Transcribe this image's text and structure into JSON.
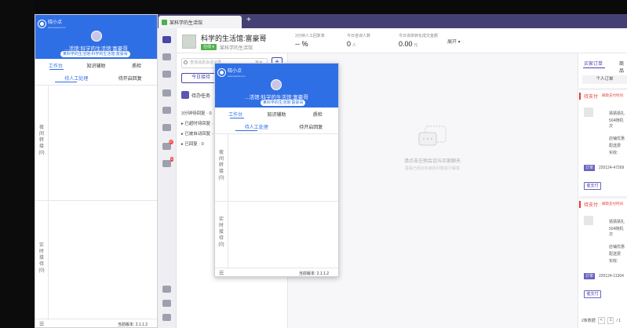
{
  "app": {
    "tab_title": "某科学的生活馆",
    "new_tab": "+"
  },
  "iconbar": {
    "items": [
      {
        "icon": "chat-icon"
      },
      {
        "icon": "doc-icon"
      },
      {
        "icon": "bag-icon"
      },
      {
        "icon": "chart-icon"
      },
      {
        "icon": "grid-icon"
      },
      {
        "icon": "shield-icon"
      },
      {
        "icon": "calendar-icon",
        "badge": "67"
      },
      {
        "icon": "megaphone-icon",
        "badge": "5"
      }
    ],
    "bottom": [
      {
        "icon": "video-icon"
      },
      {
        "icon": "home-icon"
      },
      {
        "icon": "menu-icon"
      }
    ]
  },
  "header": {
    "shop_name": "科学的生活馆:富豪哥",
    "status": "在线 ▾",
    "sub_name": "某科学的生活馆",
    "stats": [
      {
        "label": "3分钟人工回复率",
        "value": "-- %",
        "unit": ""
      },
      {
        "label": "今日咨询人数",
        "value": "0",
        "unit": "人"
      },
      {
        "label": "今日询单转化成交金额",
        "value": "0.00",
        "unit": "元"
      }
    ],
    "expand": "展开 ▾"
  },
  "convlist": {
    "search_placeholder": "查询消息会话记录",
    "search_more": "更多",
    "add": "+",
    "today_btn": "今日接待",
    "pending_title": "待办任务",
    "groups": [
      "3分钟待回复 · 0",
      "▸ 已超时待回复 · 0",
      "▸ 已被自动回复 · 0",
      "▸ 已回复 · 0"
    ]
  },
  "chat": {
    "empty_text": "请点击左侧会话与买家聊天",
    "empty_sub": "看看已经对买家的问题进行解答"
  },
  "orders": {
    "tab_buyer": "买家订单",
    "tab_goods": "商品",
    "sub_btn": "个人订单",
    "cards": [
      {
        "status": "待支付",
        "status2": "邮政支付时间",
        "lines": [
          "猜猜猜扎",
          "504随机次"
        ],
        "lines2": [
          "店铺优惠",
          "配送费",
          "实收:"
        ],
        "tag": "订单",
        "num": "220124-47269",
        "pay": "催支付"
      },
      {
        "status": "待支付",
        "status2": "邮政支付时间",
        "lines": [
          "猜猜猜扎",
          "504随机次"
        ],
        "lines2": [
          "店铺优惠",
          "配送费",
          "实收:"
        ],
        "tag": "订单",
        "num": "220124-11304",
        "pay": "催支付"
      }
    ],
    "pager_total": "2条数据",
    "pager_prev": "<",
    "pager_page": "1",
    "pager_sep": "/ 1"
  },
  "plugin_left": {
    "brand": "晓小点",
    "brand_sub": "www.xiaoxd.com",
    "name": "...活馆:科学的生活馆:富豪哥",
    "pill": "某科学的生活馆:科学的生活馆:富豪哥",
    "tabs": [
      "工作台",
      "知识辅助",
      "质检"
    ],
    "subtabs": [
      "待人工处理",
      "待开启回复"
    ],
    "vlabel1": "夜间转接(0)",
    "vlabel2": "实时接待(0)",
    "version": "当前版本: 2.1.1.2"
  },
  "plugin_float": {
    "brand": "晓小点",
    "brand_sub": "www.xiaoxd.com",
    "name": "...活馆:科学的生活馆:富豪哥",
    "pill": "某科学的生活馆:富豪哥",
    "tabs": [
      "工作台",
      "知识辅助",
      "质检"
    ],
    "subtabs": [
      "待人工处理",
      "待开启回复"
    ],
    "vlabel1": "夜间转接(0)",
    "vlabel2": "实时接待(0)",
    "version": "当前版本: 2.1.1.2"
  }
}
